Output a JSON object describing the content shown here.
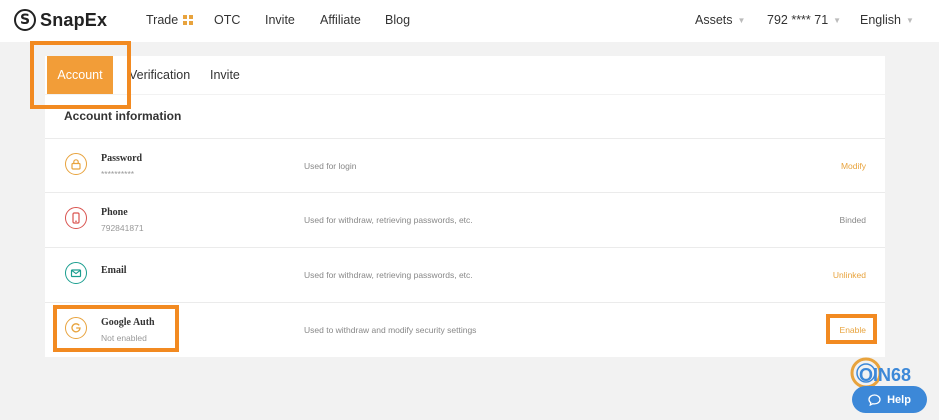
{
  "brand": {
    "name": "SnapEx",
    "logo_glyph": "S"
  },
  "nav": {
    "items": [
      "Trade",
      "OTC",
      "Invite",
      "Affiliate",
      "Blog"
    ],
    "assets": "Assets",
    "account": "792 **** 71",
    "language": "English"
  },
  "tabs": [
    "Account",
    "Verification",
    "Invite"
  ],
  "section_title": "Account information",
  "rows": [
    {
      "icon": "lock-icon",
      "name": "Password",
      "sub": "**********",
      "desc": "Used for login",
      "action": "Modify",
      "action_color": "#e8a33d"
    },
    {
      "icon": "phone-icon",
      "name": "Phone",
      "sub": "792841871",
      "desc": "Used for withdraw, retrieving passwords, etc.",
      "action": "Binded",
      "action_color": "#888888"
    },
    {
      "icon": "mail-icon",
      "name": "Email",
      "sub": "",
      "desc": "Used for withdraw, retrieving passwords, etc.",
      "action": "Unlinked",
      "action_color": "#e8a33d"
    },
    {
      "icon": "google-auth-icon",
      "name": "Google Auth",
      "sub": "Not enabled",
      "desc": "Used to withdraw and modify security settings",
      "action": "Enable",
      "action_color": "#e8a33d"
    }
  ],
  "watermark": {
    "text": "OIN68"
  },
  "help": {
    "label": "Help"
  },
  "colors": {
    "accent": "#f29d38",
    "highlight": "#f28a21",
    "help_bg": "#3c88d8"
  }
}
